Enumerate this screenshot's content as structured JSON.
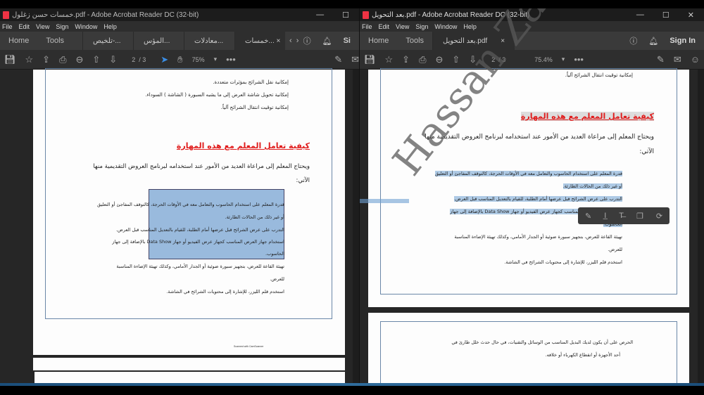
{
  "left_window": {
    "title": "خمسات حسن زغلول.pdf - Adobe Acrobat Reader DC (32-bit)",
    "menu": [
      "File",
      "Edit",
      "View",
      "Sign",
      "Window",
      "Help"
    ],
    "nav": {
      "home": "Home",
      "tools": "Tools"
    },
    "tabs": [
      "تلخيص-...",
      "المؤس...",
      "معادلات...",
      "خمسات..."
    ],
    "sign_in": "Si",
    "page_current": "2",
    "page_total": "/ 3",
    "zoom": "75%",
    "doc": {
      "bullets_top": [
        "إمكانية نقل الشرائح بمؤثرات متعددة.",
        "إمكانية تحويل شاشة العرض إلى ما يشبه السبورة ( الشاشة ) السوداء.",
        "إمكانية توقيت انتقال الشرائح آلياً."
      ],
      "heading": "كيفية تعامل المعلم مع هذه المهارة",
      "intro": "ويحتاج المعلم إلى مراعاة العديد من الأمور عند استخدامه لبرنامج العروض التقديمية منها",
      "intro2": "الآتي:",
      "items": [
        "قدرة المعلم على استخدام الحاسوب والتعامل معه في الأوقات الحرجة، كالتوقف المفاجئ أو التعليق",
        "أو غير ذلك من الحالات الطارئة.",
        "التدرب على عرض الشرائح قبل عرضها أمام الطلبة، للقيام بالتعديل المناسب قبل العرض.",
        "استخدام جهاز العرض المناسب كجهاز عرض الفيديو أو جهاز Data Show بالإضافة إلى جهاز",
        "الحاسوب.",
        "تهيئة القاعة للعرض، بتجهيز سبورة ضوئية أو الجدار الأمامي، وكذلك تهيئة الإضاءة المناسبة",
        "للعرض.",
        "استخدم قلم الليزر، للإشارة إلى محتويات الشرائح في الشاشة."
      ],
      "footer": "Scanned with CamScanner"
    }
  },
  "right_window": {
    "title": "بعد التحويل.pdf - Adobe Acrobat Reader DC (32-bit)",
    "menu": [
      "File",
      "Edit",
      "View",
      "Sign",
      "Window",
      "Help"
    ],
    "nav": {
      "home": "Home",
      "tools": "Tools"
    },
    "tab": "بعد التحويل.pdf",
    "sign_in": "Sign In",
    "page_current": "2",
    "page_total": "/ 3",
    "zoom": "75.4%",
    "doc": {
      "bullet_top": "إمكانية توقيت انتقال الشرائح آلياً.",
      "watermark": "Hassan Za",
      "next_page_item": "الحرص على أن يكون لديك البديل المناسب من الوسائل والتقنيات، في حال حدث خلل طارئ في",
      "next_page_item2": "أحد الأجهزة أو انقطاع الكهرباء أو خلافه."
    }
  }
}
